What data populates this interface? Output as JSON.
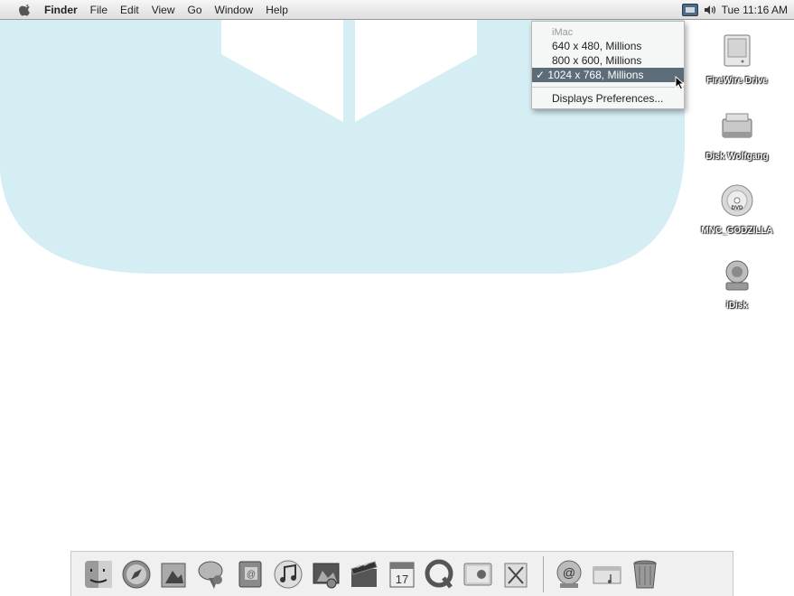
{
  "menubar": {
    "app_name": "Finder",
    "menus": [
      "File",
      "Edit",
      "View",
      "Go",
      "Window",
      "Help"
    ],
    "clock": "Tue 11:16 AM"
  },
  "display_menu": {
    "header": "iMac",
    "items": [
      {
        "label": "640 x 480, Millions",
        "selected": false
      },
      {
        "label": "800 x 600, Millions",
        "selected": false
      },
      {
        "label": "✓ 1024 x 768, Millions",
        "selected": true
      }
    ],
    "preferences": "Displays Preferences..."
  },
  "desktop_icons": [
    {
      "label": "FireWire Drive",
      "icon": "external-drive-icon"
    },
    {
      "label": "Disk Wolfgang",
      "icon": "hard-drive-icon"
    },
    {
      "label": "MNC_GODZILLA",
      "icon": "dvd-icon"
    },
    {
      "label": "iDisk",
      "icon": "idisk-icon"
    }
  ],
  "dock": {
    "apps": [
      "finder-icon",
      "safari-icon",
      "preview-icon",
      "ichat-icon",
      "address-book-icon",
      "itunes-icon",
      "iphoto-icon",
      "imovie-icon",
      "ical-icon",
      "quicktime-icon",
      "system-preferences-icon",
      "iwork-icon"
    ],
    "others": [
      "mail-icon",
      "documents-folder-icon",
      "trash-icon"
    ]
  },
  "colors": {
    "background_shape": "#d5eef4",
    "menu_selection": "#5d6c79"
  }
}
